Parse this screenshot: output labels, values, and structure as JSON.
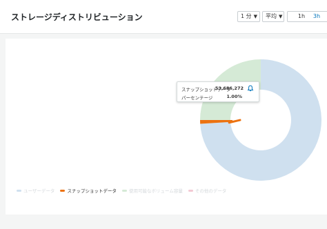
{
  "widget": {
    "title": "ストレージディストリビューション",
    "period_label": "1 分",
    "stat_label": "平均",
    "range_options": [
      "1h",
      "3h"
    ],
    "active_range": "3h"
  },
  "tooltip": {
    "series_label": "スナップショットデータ",
    "series_value": "53,686,272",
    "percent_label": "パーセンテージ",
    "percent_value": "1.00%",
    "icon": "bell-icon"
  },
  "chart_data": {
    "type": "pie",
    "donut": true,
    "slices": [
      {
        "name": "ユーザーデータ",
        "value": 74.0,
        "color": "#cfe0ef"
      },
      {
        "name": "スナップショットデータ",
        "value": 1.0,
        "color": "#ec7211"
      },
      {
        "name": "使用可能なボリューム容量",
        "value": 25.0,
        "color": "#d5ead6"
      },
      {
        "name": "その他のデータ",
        "value": 0.0,
        "color": "#f3c9d3"
      }
    ],
    "highlighted": "スナップショットデータ",
    "legend_position": "bottom-left"
  }
}
